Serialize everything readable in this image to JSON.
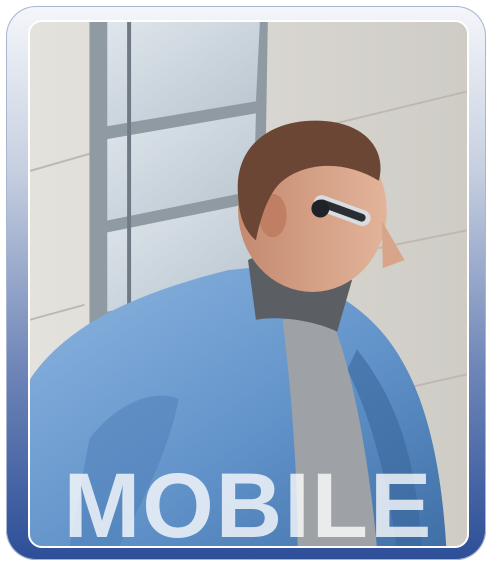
{
  "caption": {
    "text": "MOBILE"
  },
  "colors": {
    "frame_top": "#f4f6fa",
    "frame_bottom": "#2d4f98",
    "jacket": "#6a9bd0",
    "wall": "#dcd9d3"
  },
  "icons": {
    "headset": "bluetooth-headset-icon"
  }
}
